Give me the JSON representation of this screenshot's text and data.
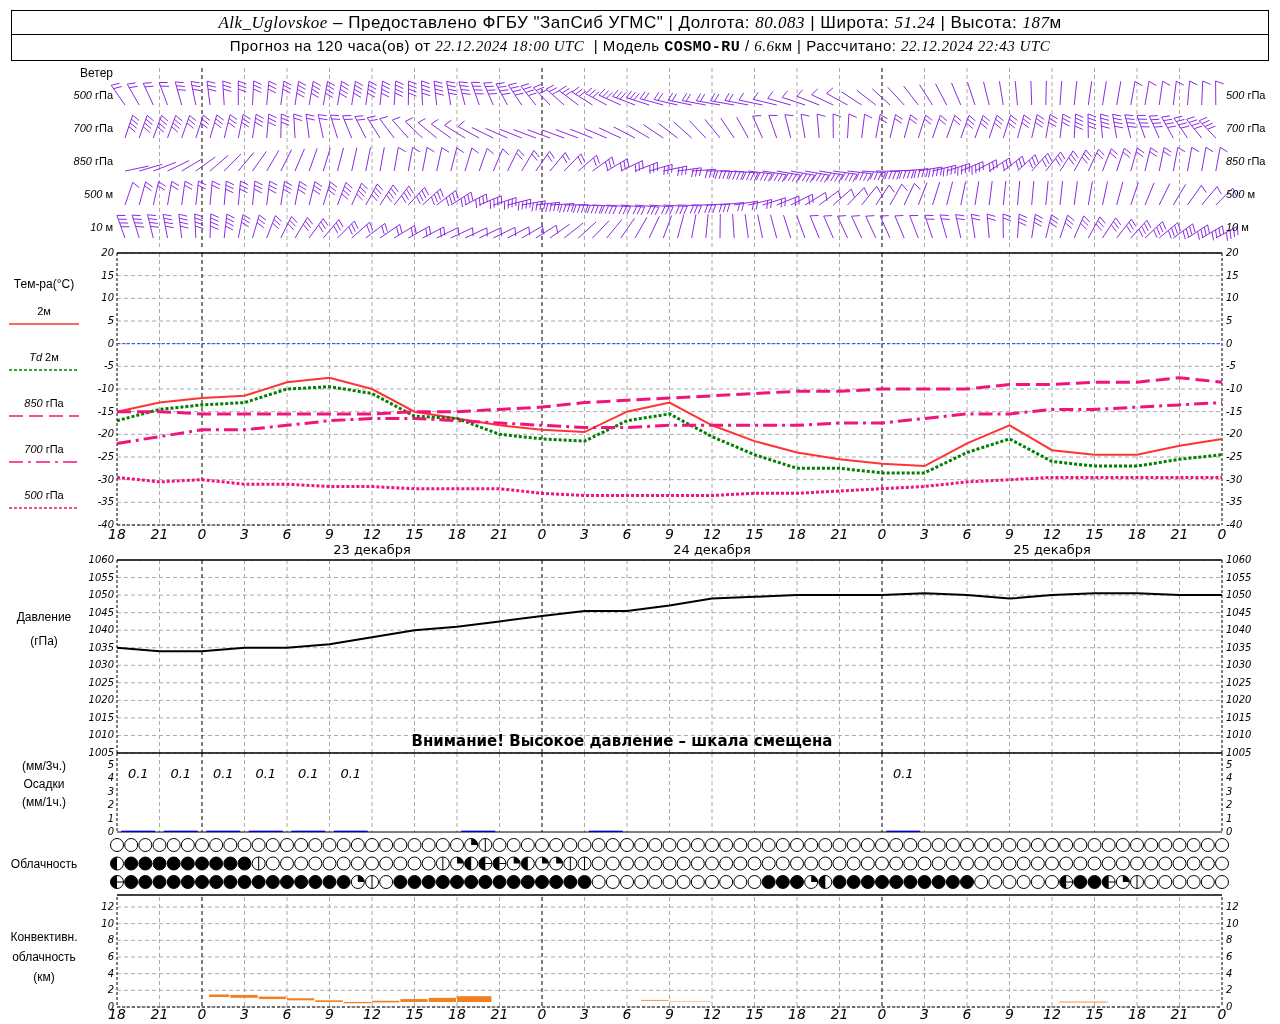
{
  "header": {
    "line_1": [
      "Alk_Uglovskoe",
      " – Предоставлено ФГБУ \"ЗапСиб УГМС\" | Долгота: ",
      "80.083",
      " | Широта: ",
      "51.24",
      " | Высота: ",
      "187",
      "м"
    ],
    "line_2": [
      "Прогноз на 120 часа(ов) от ",
      "22.12.2024 18:00 UTC",
      "  | Модель ",
      "COSMO-RU",
      " / ",
      "6.6",
      "км | Рассчитано: ",
      "22.12.2024 22:43 UTC"
    ]
  },
  "wind": {
    "title": "Ветер",
    "levels_left": [
      "*500* гПа",
      "*700* гПа",
      "*850* гПа",
      "*500* м",
      "*10* м"
    ],
    "levels_right": [
      "*500* гПа",
      "*700* гПа",
      "*850* гПа",
      "*500* м",
      "*10* м"
    ]
  },
  "temperature": {
    "title": "Тем-ра(°С)",
    "right_axis": [
      "20",
      "15",
      "10",
      "5",
      "0",
      "-5",
      "-10",
      "-15",
      "-20",
      "-25",
      "-30",
      "-35",
      "-40"
    ],
    "dates": [
      "23 декабря",
      "24 декабря",
      "25 декабря"
    ],
    "chart_data": {
      "type": "line",
      "grid": true,
      "categories": [
        "18",
        "21",
        "0",
        "3",
        "6",
        "9",
        "12",
        "15",
        "18",
        "21",
        "0",
        "3",
        "6",
        "9",
        "12",
        "15",
        "18",
        "21",
        "0",
        "3",
        "6",
        "9",
        "12",
        "15",
        "18",
        "21",
        "0"
      ],
      "ylim": [
        -40,
        20
      ],
      "yticks": [
        20,
        15,
        10,
        5,
        0,
        -5,
        -10,
        -15,
        -20,
        -25,
        -30,
        -35,
        -40
      ],
      "ref_lines": [
        {
          "axis": "y",
          "value": 0,
          "color": "#2040ff",
          "line_style": "dotted"
        }
      ],
      "series": [
        {
          "name": "2м",
          "color": "#ff3333",
          "line_style": "solid",
          "values": [
            -15,
            -13,
            -12,
            -11.5,
            -8.5,
            -7.5,
            -10,
            -15,
            -16.5,
            -18,
            -19,
            -19.5,
            -15,
            -13,
            -18,
            -21.5,
            -24,
            -25.5,
            -26.5,
            -27,
            -22,
            -18,
            -23.5,
            -24.5,
            -24.5,
            -22.5,
            -21
          ]
        },
        {
          "name": "*Td* 2м",
          "color": "#008000",
          "line_style": "dotted",
          "values": [
            -17,
            -14.5,
            -13.5,
            -13,
            -10,
            -9.5,
            -11,
            -16,
            -16.5,
            -20,
            -21,
            -21.5,
            -17,
            -15.5,
            -20.5,
            -24.5,
            -27.5,
            -27.5,
            -28.5,
            -28.5,
            -24,
            -21,
            -26,
            -27,
            -27,
            -25.5,
            -24.5
          ]
        },
        {
          "name": "*850* гПа",
          "color": "#f0147c",
          "line_style": "dashed",
          "values": [
            -15,
            -15,
            -15.5,
            -15.5,
            -15.5,
            -15.5,
            -15.5,
            -15,
            -15,
            -14.5,
            -14,
            -13,
            -12.5,
            -12,
            -11.5,
            -11,
            -10.5,
            -10.5,
            -10,
            -10,
            -10,
            -9,
            -9,
            -8.5,
            -8.5,
            -7.5,
            -8.5
          ]
        },
        {
          "name": "*700* гПа",
          "color": "#f0147c",
          "line_style": "dashdot",
          "values": [
            -22,
            -20.5,
            -19,
            -19,
            -18,
            -17,
            -16.5,
            -16.5,
            -17,
            -17.5,
            -18,
            -18.5,
            -18.5,
            -18,
            -18,
            -18,
            -18,
            -17.5,
            -17.5,
            -16.5,
            -15.5,
            -15.5,
            -14.5,
            -14.5,
            -14,
            -13.5,
            -13
          ]
        },
        {
          "name": "*500* гПа",
          "color": "#f0147c",
          "line_style": "dotted",
          "values": [
            -29.5,
            -30.5,
            -30,
            -31,
            -31,
            -31.5,
            -31.5,
            -32,
            -32,
            -32,
            -33,
            -33.5,
            -33.5,
            -33.5,
            -33.5,
            -33,
            -33,
            -32.5,
            -32,
            -31.5,
            -30.5,
            -30,
            -29.5,
            -29.5,
            -29.5,
            -29.5,
            -29.5
          ]
        }
      ]
    }
  },
  "pressure": {
    "unit": "(гПа)",
    "warning": "Внимание! Высокое давление – шкала смещена",
    "right_axis": [
      "1060",
      "1055",
      "1050",
      "1045",
      "1040",
      "1035",
      "1030",
      "1025",
      "1020",
      "1015",
      "1010",
      "1005"
    ],
    "chart_data": {
      "type": "line",
      "grid": true,
      "categories": [
        null,
        null,
        null,
        null,
        null,
        null,
        null,
        null,
        null,
        null,
        null,
        null,
        null,
        null,
        null,
        null,
        null,
        null,
        null,
        null,
        null,
        null,
        null,
        null,
        null,
        null,
        null
      ],
      "ylim": [
        1005,
        1060
      ],
      "yticks": [
        1060,
        1055,
        1050,
        1045,
        1040,
        1035,
        1030,
        1025,
        1020,
        1015,
        1010,
        1005
      ],
      "series": [
        {
          "name": "Давление",
          "color": "#000000",
          "values": [
            1035,
            1034,
            1034,
            1035,
            1035,
            1036,
            1038,
            1040,
            1041,
            1042.5,
            1044,
            1045.5,
            1045.5,
            1047,
            1049,
            1049.5,
            1050,
            1050,
            1050,
            1050.5,
            1050,
            1049,
            1050,
            1050.5,
            1050.5,
            1050,
            1050
          ]
        }
      ]
    }
  },
  "precipitation": {
    "labels": [
      "(мм/3ч.)",
      "(мм/1ч.)"
    ],
    "right_axis": [
      "5",
      "4",
      "3",
      "2",
      "1",
      "0"
    ],
    "chart_data": {
      "type": "bar",
      "grid": true,
      "categories": [
        null,
        null,
        null,
        null,
        null,
        null,
        null,
        null,
        null,
        null,
        null,
        null,
        null,
        null,
        null,
        null,
        null,
        null,
        null,
        null,
        null,
        null,
        null,
        null,
        null,
        null
      ],
      "ylim": [
        0,
        5.9
      ],
      "yticks": [
        5,
        4,
        3,
        2,
        1,
        0
      ],
      "series": [
        {
          "name": "Осадки",
          "color": "#0000cc",
          "values": [
            0.1,
            0.1,
            0.1,
            0.1,
            0.1,
            0.1,
            null,
            null,
            0.1,
            null,
            null,
            0.1,
            null,
            null,
            null,
            null,
            null,
            null,
            0.1,
            null,
            null,
            null,
            null,
            null,
            null,
            null
          ]
        }
      ],
      "value_labels": [
        "0.1",
        "0.1",
        "0.1",
        "0.1",
        "0.1",
        "0.1",
        null,
        null,
        null,
        null,
        null,
        null,
        null,
        null,
        null,
        null,
        null,
        null,
        "0.1",
        null,
        null,
        null,
        null,
        null,
        null,
        null
      ]
    }
  },
  "clouds": {
    "title": "Облачность",
    "rows": [
      {
        "cells": [
          {
            "kind": "clear"
          },
          {
            "kind": "clear"
          },
          {
            "kind": "clear"
          },
          {
            "kind": "clear"
          },
          {
            "kind": "clear"
          },
          {
            "kind": "clear"
          },
          {
            "kind": "clear"
          },
          {
            "kind": "clear"
          },
          {
            "kind": "clear"
          },
          {
            "kind": "clear"
          },
          {
            "kind": "clear"
          },
          {
            "kind": "clear"
          },
          {
            "kind": "clear"
          },
          {
            "kind": "clear"
          },
          {
            "kind": "clear"
          },
          {
            "kind": "clear"
          },
          {
            "kind": "clear"
          },
          {
            "kind": "clear"
          },
          {
            "kind": "clear"
          },
          {
            "kind": "clear"
          },
          {
            "kind": "clear"
          },
          {
            "kind": "clear"
          },
          {
            "kind": "clear"
          },
          {
            "kind": "clear"
          },
          {
            "kind": "clear"
          },
          {
            "kind": "quarter"
          },
          {
            "kind": "line"
          },
          {
            "kind": "clear"
          },
          {
            "kind": "clear"
          },
          {
            "kind": "clear"
          },
          {
            "kind": "clear"
          },
          {
            "kind": "clear"
          },
          {
            "kind": "clear"
          },
          {
            "kind": "clear"
          },
          {
            "kind": "clear"
          },
          {
            "kind": "clear"
          },
          {
            "kind": "clear"
          },
          {
            "kind": "clear"
          },
          {
            "kind": "clear"
          },
          {
            "kind": "clear"
          },
          {
            "kind": "clear"
          },
          {
            "kind": "clear"
          },
          {
            "kind": "clear"
          },
          {
            "kind": "clear"
          },
          {
            "kind": "clear"
          },
          {
            "kind": "clear"
          },
          {
            "kind": "clear"
          },
          {
            "kind": "clear"
          },
          {
            "kind": "clear"
          },
          {
            "kind": "clear"
          },
          {
            "kind": "clear"
          },
          {
            "kind": "clear"
          },
          {
            "kind": "clear"
          },
          {
            "kind": "clear"
          },
          {
            "kind": "clear"
          },
          {
            "kind": "clear"
          },
          {
            "kind": "clear"
          },
          {
            "kind": "clear"
          },
          {
            "kind": "clear"
          },
          {
            "kind": "clear"
          },
          {
            "kind": "clear"
          },
          {
            "kind": "clear"
          },
          {
            "kind": "clear"
          },
          {
            "kind": "clear"
          },
          {
            "kind": "clear"
          },
          {
            "kind": "clear"
          },
          {
            "kind": "clear"
          },
          {
            "kind": "clear"
          },
          {
            "kind": "clear"
          },
          {
            "kind": "clear"
          },
          {
            "kind": "clear"
          },
          {
            "kind": "clear"
          },
          {
            "kind": "clear"
          },
          {
            "kind": "clear"
          },
          {
            "kind": "clear"
          },
          {
            "kind": "clear"
          },
          {
            "kind": "clear"
          },
          {
            "kind": "clear"
          },
          {
            "kind": "clear"
          }
        ]
      },
      {
        "cells": [
          {
            "kind": "half"
          },
          {
            "kind": "full"
          },
          {
            "kind": "full"
          },
          {
            "kind": "full"
          },
          {
            "kind": "full"
          },
          {
            "kind": "full"
          },
          {
            "kind": "full"
          },
          {
            "kind": "full"
          },
          {
            "kind": "full"
          },
          {
            "kind": "full"
          },
          {
            "kind": "line"
          },
          {
            "kind": "clear"
          },
          {
            "kind": "clear"
          },
          {
            "kind": "clear"
          },
          {
            "kind": "clear"
          },
          {
            "kind": "clear"
          },
          {
            "kind": "clear"
          },
          {
            "kind": "clear"
          },
          {
            "kind": "clear"
          },
          {
            "kind": "clear"
          },
          {
            "kind": "clear"
          },
          {
            "kind": "clear"
          },
          {
            "kind": "clear"
          },
          {
            "kind": "line"
          },
          {
            "kind": "quarter"
          },
          {
            "kind": "half"
          },
          {
            "kind": "bar"
          },
          {
            "kind": "bar"
          },
          {
            "kind": "quarter"
          },
          {
            "kind": "half"
          },
          {
            "kind": "quarter"
          },
          {
            "kind": "quarter"
          },
          {
            "kind": "line"
          },
          {
            "kind": "line"
          },
          {
            "kind": "clear"
          },
          {
            "kind": "clear"
          },
          {
            "kind": "clear"
          },
          {
            "kind": "clear"
          },
          {
            "kind": "clear"
          },
          {
            "kind": "clear"
          },
          {
            "kind": "clear"
          },
          {
            "kind": "clear"
          },
          {
            "kind": "clear"
          },
          {
            "kind": "clear"
          },
          {
            "kind": "clear"
          },
          {
            "kind": "clear"
          },
          {
            "kind": "clear"
          },
          {
            "kind": "clear"
          },
          {
            "kind": "clear"
          },
          {
            "kind": "clear"
          },
          {
            "kind": "clear"
          },
          {
            "kind": "clear"
          },
          {
            "kind": "clear"
          },
          {
            "kind": "clear"
          },
          {
            "kind": "clear"
          },
          {
            "kind": "clear"
          },
          {
            "kind": "clear"
          },
          {
            "kind": "clear"
          },
          {
            "kind": "clear"
          },
          {
            "kind": "clear"
          },
          {
            "kind": "clear"
          },
          {
            "kind": "clear"
          },
          {
            "kind": "clear"
          },
          {
            "kind": "clear"
          },
          {
            "kind": "clear"
          },
          {
            "kind": "clear"
          },
          {
            "kind": "clear"
          },
          {
            "kind": "clear"
          },
          {
            "kind": "clear"
          },
          {
            "kind": "clear"
          },
          {
            "kind": "clear"
          },
          {
            "kind": "clear"
          },
          {
            "kind": "clear"
          },
          {
            "kind": "clear"
          },
          {
            "kind": "clear"
          },
          {
            "kind": "clear"
          },
          {
            "kind": "clear"
          },
          {
            "kind": "clear"
          },
          {
            "kind": "clear"
          }
        ]
      },
      {
        "cells": [
          {
            "kind": "bar"
          },
          {
            "kind": "full"
          },
          {
            "kind": "full"
          },
          {
            "kind": "full"
          },
          {
            "kind": "full"
          },
          {
            "kind": "full"
          },
          {
            "kind": "full"
          },
          {
            "kind": "full"
          },
          {
            "kind": "full"
          },
          {
            "kind": "full"
          },
          {
            "kind": "full"
          },
          {
            "kind": "full"
          },
          {
            "kind": "full"
          },
          {
            "kind": "full"
          },
          {
            "kind": "full"
          },
          {
            "kind": "full"
          },
          {
            "kind": "full"
          },
          {
            "kind": "quarter"
          },
          {
            "kind": "line"
          },
          {
            "kind": "clear"
          },
          {
            "kind": "full"
          },
          {
            "kind": "full"
          },
          {
            "kind": "full"
          },
          {
            "kind": "full"
          },
          {
            "kind": "full"
          },
          {
            "kind": "full"
          },
          {
            "kind": "full"
          },
          {
            "kind": "full"
          },
          {
            "kind": "full"
          },
          {
            "kind": "full"
          },
          {
            "kind": "full"
          },
          {
            "kind": "full"
          },
          {
            "kind": "full"
          },
          {
            "kind": "full"
          },
          {
            "kind": "clear"
          },
          {
            "kind": "clear"
          },
          {
            "kind": "clear"
          },
          {
            "kind": "clear"
          },
          {
            "kind": "clear"
          },
          {
            "kind": "clear"
          },
          {
            "kind": "clear"
          },
          {
            "kind": "clear"
          },
          {
            "kind": "clear"
          },
          {
            "kind": "clear"
          },
          {
            "kind": "clear"
          },
          {
            "kind": "clear"
          },
          {
            "kind": "full"
          },
          {
            "kind": "full"
          },
          {
            "kind": "full"
          },
          {
            "kind": "quarter"
          },
          {
            "kind": "half"
          },
          {
            "kind": "full"
          },
          {
            "kind": "full"
          },
          {
            "kind": "full"
          },
          {
            "kind": "full"
          },
          {
            "kind": "full"
          },
          {
            "kind": "full"
          },
          {
            "kind": "full"
          },
          {
            "kind": "full"
          },
          {
            "kind": "full"
          },
          {
            "kind": "full"
          },
          {
            "kind": "clear"
          },
          {
            "kind": "clear"
          },
          {
            "kind": "clear"
          },
          {
            "kind": "clear"
          },
          {
            "kind": "clear"
          },
          {
            "kind": "clear"
          },
          {
            "kind": "bar"
          },
          {
            "kind": "full"
          },
          {
            "kind": "full"
          },
          {
            "kind": "bar"
          },
          {
            "kind": "quarter"
          },
          {
            "kind": "line"
          },
          {
            "kind": "clear"
          },
          {
            "kind": "clear"
          },
          {
            "kind": "clear"
          },
          {
            "kind": "clear"
          },
          {
            "kind": "clear"
          },
          {
            "kind": "clear"
          }
        ]
      }
    ]
  },
  "convection": {
    "labels": [
      "Конвективн.",
      "облачность",
      "(км)"
    ],
    "left_axis": [
      "12",
      "10",
      "8",
      "6",
      "4",
      "2",
      "0"
    ],
    "right_axis": [
      "12",
      "10",
      "8",
      "6",
      "4",
      "2",
      "0"
    ]
  },
  "bottom_axis": [
    "18",
    "21",
    "0",
    "3",
    "6",
    "9",
    "12",
    "15",
    "18",
    "21",
    "0",
    "3",
    "6",
    "9",
    "12",
    "15",
    "18",
    "21",
    "0",
    "3",
    "6",
    "9",
    "12",
    "15",
    "18",
    "21",
    "0"
  ]
}
